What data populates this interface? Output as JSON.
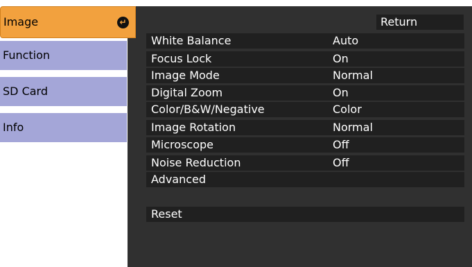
{
  "tabs": {
    "image": "Image",
    "function": "Function",
    "sd_card": "SD Card",
    "info": "Info"
  },
  "return_label": "Return",
  "menu": {
    "white_balance": {
      "label": "White Balance",
      "value": "Auto"
    },
    "focus_lock": {
      "label": "Focus Lock",
      "value": "On"
    },
    "image_mode": {
      "label": "Image Mode",
      "value": "Normal"
    },
    "digital_zoom": {
      "label": "Digital Zoom",
      "value": "On"
    },
    "color_mode": {
      "label": "Color/B&W/Negative",
      "value": "Color"
    },
    "image_rotation": {
      "label": "Image Rotation",
      "value": "Normal"
    },
    "microscope": {
      "label": "Microscope",
      "value": "Off"
    },
    "noise_reduction": {
      "label": "Noise Reduction",
      "value": "Off"
    },
    "advanced": {
      "label": "Advanced"
    },
    "reset": {
      "label": "Reset"
    }
  },
  "icons": {
    "active_tab_icon": "enter-arrow-icon"
  },
  "colors": {
    "active_tab": "#f2a13e",
    "inactive_tab": "#a4a6d8",
    "panel_background": "#303030",
    "row_background": "#202020"
  }
}
